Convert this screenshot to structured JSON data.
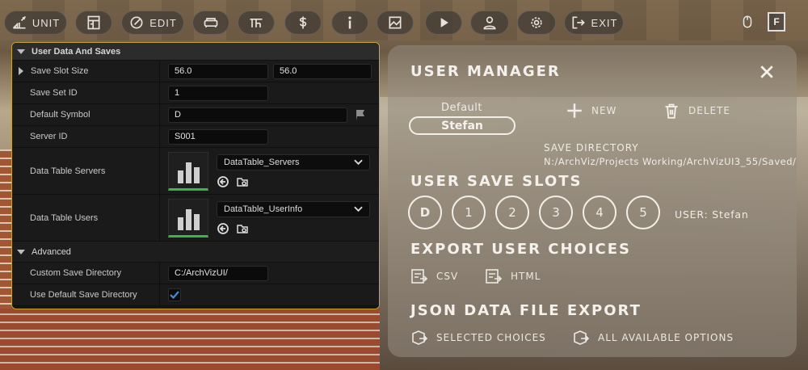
{
  "toolbar": {
    "unit_label": "UNIT",
    "edit_label": "EDIT",
    "exit_label": "EXIT",
    "f_key_label": "F",
    "icons": [
      "unit-icon",
      "floorplan-icon",
      "edit-icon",
      "sofa-icon",
      "layout-icon",
      "dollar-icon",
      "info-icon",
      "image-icon",
      "play-icon",
      "user-icon",
      "gear-icon",
      "exit-icon",
      "mouse-icon"
    ]
  },
  "details": {
    "section_title": "User Data And Saves",
    "save_slot_size": {
      "label": "Save Slot Size",
      "x": "56.0",
      "y": "56.0"
    },
    "save_set_id": {
      "label": "Save Set ID",
      "value": "1"
    },
    "default_symbol": {
      "label": "Default Symbol",
      "value": "D"
    },
    "server_id": {
      "label": "Server ID",
      "value": "S001"
    },
    "data_table_servers": {
      "label": "Data Table Servers",
      "value": "DataTable_Servers"
    },
    "data_table_users": {
      "label": "Data Table Users",
      "value": "DataTable_UserInfo"
    },
    "advanced_title": "Advanced",
    "custom_save_directory": {
      "label": "Custom Save Directory",
      "value": "C:/ArchVizUI/"
    },
    "use_default_save_directory": {
      "label": "Use Default Save Directory",
      "checked": true
    }
  },
  "user_manager": {
    "title": "USER MANAGER",
    "default_label": "Default",
    "current_user": "Stefan",
    "new_label": "NEW",
    "delete_label": "DELETE",
    "save_directory_label": "SAVE DIRECTORY",
    "save_directory_path": "N:/ArchViz/Projects Working/ArchVizUI3_55/Saved/",
    "slots_title": "USER SAVE SLOTS",
    "slots": [
      "D",
      "1",
      "2",
      "3",
      "4",
      "5"
    ],
    "user_status": "USER: Stefan",
    "export_title": "EXPORT USER CHOICES",
    "export_csv": "CSV",
    "export_html": "HTML",
    "json_title": "JSON DATA FILE EXPORT",
    "json_selected": "SELECTED CHOICES",
    "json_all": "ALL AVAILABLE OPTIONS"
  },
  "colors": {
    "panel_border": "#c7a62a",
    "thumb_accent": "#3ab54a",
    "checkbox_check": "#3c8ddf"
  }
}
